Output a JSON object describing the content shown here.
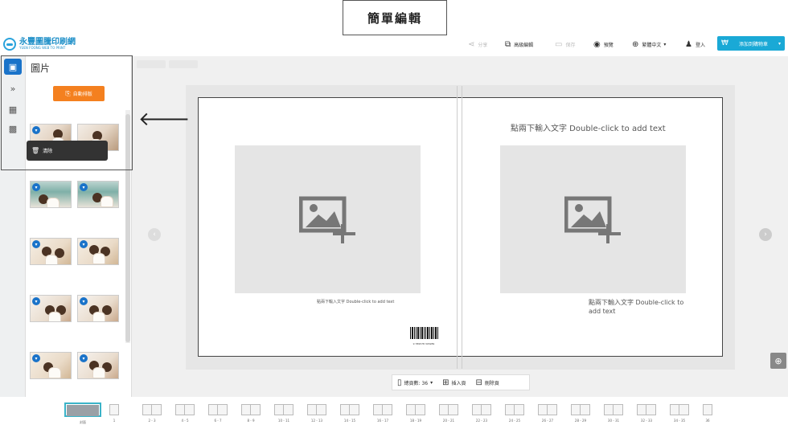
{
  "title_callout": "簡單編輯",
  "logo": {
    "name_cn": "永豐圖騰印刷網",
    "name_en": "YUEN FOONG WEB TO PRINT"
  },
  "toolbar": {
    "share": "分享",
    "advanced_edit": "高級編輯",
    "save": "保存",
    "preview": "預覽",
    "language": "繁體中文",
    "login": "登入",
    "add_to_cart": "添加到購物車"
  },
  "sidebar": {
    "photos_label": "圖片",
    "collapse_icon": "»"
  },
  "panel": {
    "auto_layout_button": "自動排版",
    "delete_tooltip": "清除"
  },
  "canvas": {
    "left_caption": "點兩下輸入文字 Double-click to add text",
    "right_title": "點兩下輸入文字 Double-click to add text",
    "right_caption": "點兩下輸入文字 Double-click to add text",
    "barcode_number": "9 789578 345289"
  },
  "page_tools": {
    "total_pages_label": "總頁數: 36",
    "insert_page": "插入頁",
    "delete_page": "刪除頁"
  },
  "filmstrip": [
    "封面",
    "1",
    "2 - 3",
    "4 - 5",
    "6 - 7",
    "8 - 9",
    "10 - 11",
    "12 - 13",
    "14 - 15",
    "16 - 17",
    "18 - 19",
    "20 - 21",
    "22 - 23",
    "24 - 25",
    "26 - 27",
    "28 - 29",
    "30 - 31",
    "32 - 33",
    "34 - 35",
    "36"
  ],
  "colors": {
    "accent": "#1a73c9",
    "orange": "#f4801f",
    "cart": "#1aa9d6",
    "cover_highlight": "#3ab3c8"
  }
}
